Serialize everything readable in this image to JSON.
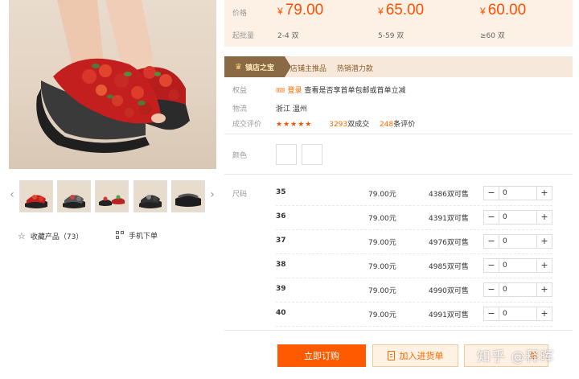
{
  "price_box": {
    "price_label": "价格",
    "moq_label": "起批量",
    "currency": "¥",
    "tiers": [
      {
        "price": "79.00",
        "moq": "2-4 双"
      },
      {
        "price": "65.00",
        "moq": "5-59 双"
      },
      {
        "price": "60.00",
        "moq": "≥60 双"
      }
    ]
  },
  "treasure": {
    "badge": "镇店之宝",
    "text_1": "店铺主推品",
    "text_2": "热销潜力款"
  },
  "info": {
    "rights_label": "权益",
    "rights_tag": "登录",
    "rights_text": "查看是否享首单包邮或首单立减",
    "logistics_label": "物流",
    "logistics_value": "浙江 温州",
    "reviews_label": "成交评价",
    "stars": "★★★★★",
    "deals": "3293",
    "deals_suffix": "双成交",
    "reviews": "248",
    "reviews_suffix": "条评价"
  },
  "color_label": "颜色",
  "size_label": "尺码",
  "sizes": [
    {
      "size": "35",
      "price": "79.00元",
      "stock": "4386双可售",
      "qty": "0"
    },
    {
      "size": "36",
      "price": "79.00元",
      "stock": "4391双可售",
      "qty": "0"
    },
    {
      "size": "37",
      "price": "79.00元",
      "stock": "4976双可售",
      "qty": "0"
    },
    {
      "size": "38",
      "price": "79.00元",
      "stock": "4985双可售",
      "qty": "0"
    },
    {
      "size": "39",
      "price": "79.00元",
      "stock": "4990双可售",
      "qty": "0"
    },
    {
      "size": "40",
      "price": "79.00元",
      "stock": "4991双可售",
      "qty": "0"
    }
  ],
  "stepper": {
    "minus": "−",
    "plus": "+"
  },
  "gallery": {
    "prev": "‹",
    "next": "›",
    "favorite_label": "收藏产品（73）",
    "mobile_label": "手机下单"
  },
  "actions": {
    "order": "立即订购",
    "cart": "加入进货单",
    "third": "单"
  },
  "watermark": "知乎 @释晖",
  "colors": {
    "accent": "#ff5000",
    "price_bg": "#fdf1e6",
    "badge": "#8a6a45"
  }
}
